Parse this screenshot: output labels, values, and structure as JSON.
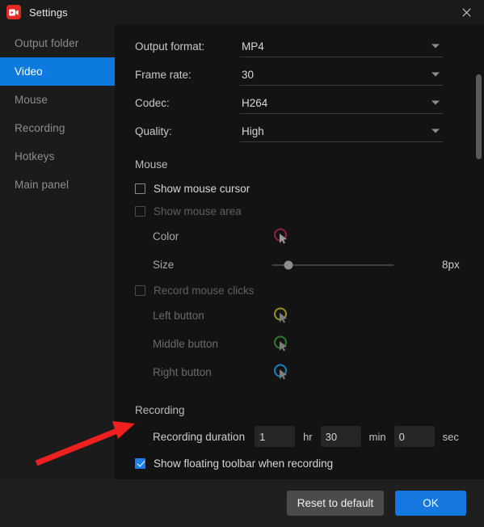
{
  "window": {
    "title": "Settings",
    "app_icon": "video-camera-icon",
    "close_icon": "close-icon"
  },
  "sidebar": {
    "items": [
      {
        "label": "Output folder",
        "active": false
      },
      {
        "label": "Video",
        "active": true
      },
      {
        "label": "Mouse",
        "active": false
      },
      {
        "label": "Recording",
        "active": false
      },
      {
        "label": "Hotkeys",
        "active": false
      },
      {
        "label": "Main panel",
        "active": false
      }
    ]
  },
  "video": {
    "fields": [
      {
        "label": "Output format:",
        "value": "MP4"
      },
      {
        "label": "Frame rate:",
        "value": "30"
      },
      {
        "label": "Codec:",
        "value": "H264"
      },
      {
        "label": "Quality:",
        "value": "High"
      }
    ]
  },
  "mouse": {
    "section_title": "Mouse",
    "show_mouse_cursor": {
      "label": "Show mouse cursor",
      "checked": false,
      "enabled": true
    },
    "show_mouse_area": {
      "label": "Show mouse area",
      "checked": false,
      "enabled": false
    },
    "color": {
      "label": "Color",
      "swatch_color": "#8e2246"
    },
    "size": {
      "label": "Size",
      "value": "8px",
      "slider_percent": 13
    },
    "record_mouse_clicks": {
      "label": "Record mouse clicks",
      "checked": false,
      "enabled": false
    },
    "buttons": [
      {
        "label": "Left button",
        "swatch_color": "#9a9020"
      },
      {
        "label": "Middle button",
        "swatch_color": "#2b7a2b"
      },
      {
        "label": "Right button",
        "swatch_color": "#1782c0"
      }
    ]
  },
  "recording": {
    "section_title": "Recording",
    "duration": {
      "label": "Recording duration",
      "hours": "1",
      "hours_unit": "hr",
      "minutes": "30",
      "minutes_unit": "min",
      "seconds": "0",
      "seconds_unit": "sec"
    },
    "floating_toolbar": {
      "label": "Show floating toolbar when recording",
      "checked": true
    }
  },
  "footer": {
    "reset_label": "Reset to default",
    "ok_label": "OK"
  },
  "annotation": {
    "arrow_color": "#ef2020"
  },
  "colors": {
    "accent": "#1478e0",
    "sidebar_active": "#0d7ae0",
    "app_icon": "#e02b23",
    "window_bg": "#1b1b1b",
    "content_bg": "#131313",
    "footer_bg": "#1f1f1f"
  }
}
